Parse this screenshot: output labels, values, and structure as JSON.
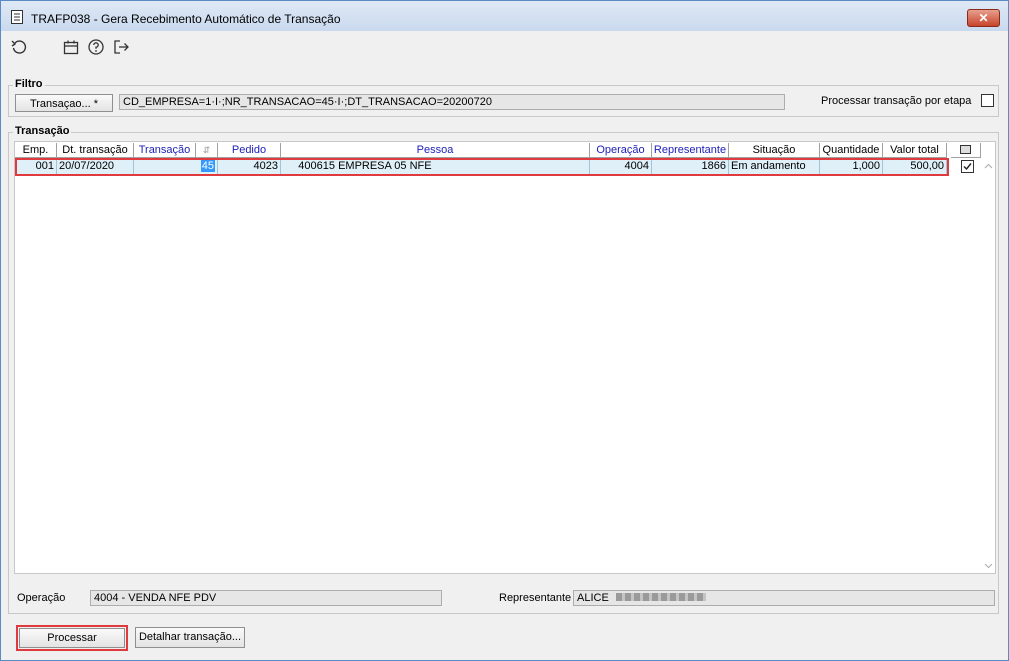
{
  "window": {
    "title": "TRAFP038 - Gera Recebimento Automático de Transação",
    "close_label": "✕"
  },
  "toolbar": {
    "icons": [
      "refresh-icon",
      "calendar-icon",
      "help-icon",
      "exit-icon"
    ]
  },
  "filtro": {
    "legend": "Filtro",
    "button_label": "Transaçao... *",
    "filter_value": "CD_EMPRESA=1·I·;NR_TRANSACAO=45·I·;DT_TRANSACAO=20200720",
    "processar_etapa_label": "Processar transação por etapa",
    "processar_etapa_checked": false
  },
  "transacao": {
    "legend": "Transação",
    "columns": [
      "Emp.",
      "Dt. transação",
      "Transação",
      "",
      "Pedido",
      "Pessoa",
      "Operação",
      "Representante",
      "Situação",
      "Quantidade",
      "Valor total",
      ""
    ],
    "rows": [
      {
        "emp": "001",
        "dt_transacao": "20/07/2020",
        "transacao": "45",
        "pedido": "4023",
        "pessoa_code": "400615",
        "pessoa_name": "EMPRESA 05 NFE",
        "operacao": "4004",
        "representante": "1866",
        "situacao": "Em andamento",
        "quantidade": "1,000",
        "valor_total": "500,00",
        "checked": true
      }
    ]
  },
  "footer": {
    "operacao_label": "Operação",
    "operacao_value": "4004 - VENDA NFE PDV",
    "representante_label": "Representante",
    "representante_value": "ALICE"
  },
  "actions": {
    "processar_label": "Processar",
    "detalhar_label": "Detalhar transação..."
  }
}
